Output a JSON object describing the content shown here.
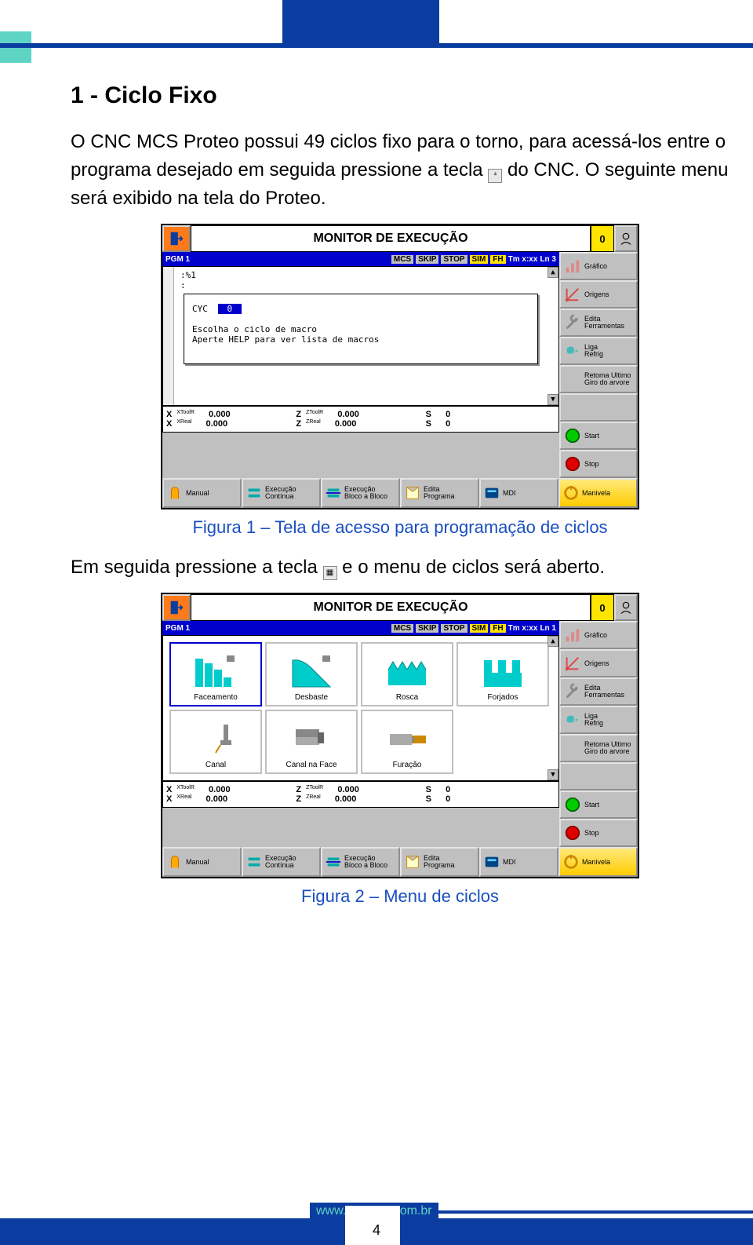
{
  "doc": {
    "heading": "1 - Ciclo Fixo",
    "para1a": "O CNC MCS Proteo possui 49 ciclos fixo para o torno, para acessá-los entre o programa desejado em seguida pressione a tecla ",
    "para1b": " do CNC. O seguinte menu será exibido na tela do Proteo.",
    "caption1": "Figura 1 – Tela de acesso para programação de ciclos",
    "para2a": "Em seguida pressione a tecla ",
    "para2b": " e o menu de ciclos será aberto.",
    "caption2": "Figura 2 – Menu de ciclos",
    "url": "www.mcseng.com.br",
    "page": "4"
  },
  "cnc": {
    "title": "MONITOR DE EXECUÇÃO",
    "yellow": "0",
    "status": {
      "pgm": "PGM 1",
      "mcs": "MCS",
      "skip": "SKIP",
      "stop": "STOP",
      "sim": "SIM",
      "fh": "FH",
      "tm": "Tm x:xx",
      "ln1": "Ln   3",
      "ln2": "Ln   1"
    },
    "right": [
      {
        "name": "grafico",
        "label": "Gráfico"
      },
      {
        "name": "origens",
        "label": "Origens"
      },
      {
        "name": "edita-ferramentas",
        "label": "Edita\nFerramentas"
      },
      {
        "name": "liga-refrig",
        "label": "Liga\nRefrig"
      },
      {
        "name": "retoma",
        "label": "Retoma Ultimo\nGiro do arvore"
      },
      {
        "name": "blank",
        "label": ""
      },
      {
        "name": "start",
        "label": "Start"
      },
      {
        "name": "stop",
        "label": "Stop"
      }
    ],
    "editor1": {
      "line1": ":%1",
      "line2": ":",
      "dlg_label": "CYC",
      "dlg_value": "0",
      "dlg_text1": "Escolha o ciclo de macro",
      "dlg_text2": "Aperte HELP para ver lista de macros"
    },
    "cycles": [
      {
        "name": "faceamento",
        "label": "Faceamento"
      },
      {
        "name": "desbaste",
        "label": "Desbaste"
      },
      {
        "name": "rosca",
        "label": "Rosca"
      },
      {
        "name": "forjados",
        "label": "Forjados"
      },
      {
        "name": "canal",
        "label": "Canal"
      },
      {
        "name": "canal-face",
        "label": "Canal na Face"
      },
      {
        "name": "furacao",
        "label": "Furação"
      }
    ],
    "coords": {
      "xtoolr": "XToolR",
      "xtoolr_v": "0.000",
      "xreal": "XReal",
      "xreal_v": "0.000",
      "ztoolr": "ZToolR",
      "ztoolr_v": "0.000",
      "zreal": "ZReal",
      "zreal_v": "0.000",
      "s": "S",
      "s_v": "0"
    },
    "bottom": [
      {
        "name": "manual",
        "label": "Manual"
      },
      {
        "name": "exec-continua",
        "label": "Execução\nContínua"
      },
      {
        "name": "exec-bloco",
        "label": "Execução\nBloco a Bloco"
      },
      {
        "name": "edita-programa",
        "label": "Edita\nPrograma"
      },
      {
        "name": "mdi",
        "label": "MDI"
      },
      {
        "name": "manivela",
        "label": "Manivela"
      }
    ]
  }
}
